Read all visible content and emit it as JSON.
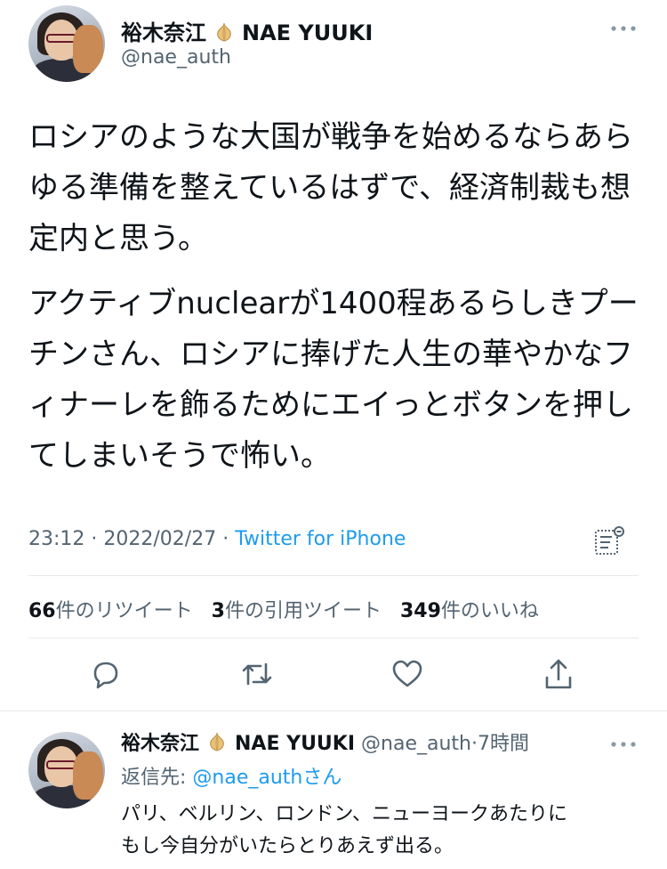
{
  "tweet": {
    "author_name": "裕木奈江",
    "author_name_en": "NAE YUUKI",
    "handle": "@nae_auth",
    "paragraphs": [
      "ロシアのような大国が戦争を始めるならあらゆる準備を整えているはずで、経済制裁も想定内と思う。",
      "アクティブnuclearが1400程あるらしきプーチンさん、ロシアに捧げた人生の華やかなフィナーレを飾るためにエイっとボタンを押してしまいそうで怖い。"
    ],
    "time": "23:12",
    "date": "2022/02/27",
    "source": "Twitter for iPhone",
    "retweets_count": "66",
    "retweets_label": "件のリツイート",
    "quotes_count": "3",
    "quotes_label": "件の引用ツイート",
    "likes_count": "349",
    "likes_label": "件のいいね"
  },
  "icons": {
    "reply": "speech-bubble-icon",
    "retweet": "retweet-arrows-icon",
    "like": "heart-icon",
    "share": "share-upload-icon",
    "more": "more-dots-icon",
    "analytics": "analytics-icon",
    "emoji": "onion-emoji-icon"
  },
  "reply": {
    "author_name": "裕木奈江",
    "author_name_en": "NAE YUUKI",
    "handle": "@nae_auth",
    "time_ago": "7時間",
    "replying_to_label": "返信先:",
    "replying_to_handle": "@nae_auth",
    "replying_to_suffix": "さん",
    "text_lines": [
      "パリ、ベルリン、ロンドン、ニューヨークあたりに",
      "もし今自分がいたらとりあえず出る。"
    ]
  },
  "colors": {
    "link": "#1d9bf0",
    "secondary_text": "#536471",
    "primary_text": "#0f1419",
    "divider": "#e6e9ec"
  }
}
